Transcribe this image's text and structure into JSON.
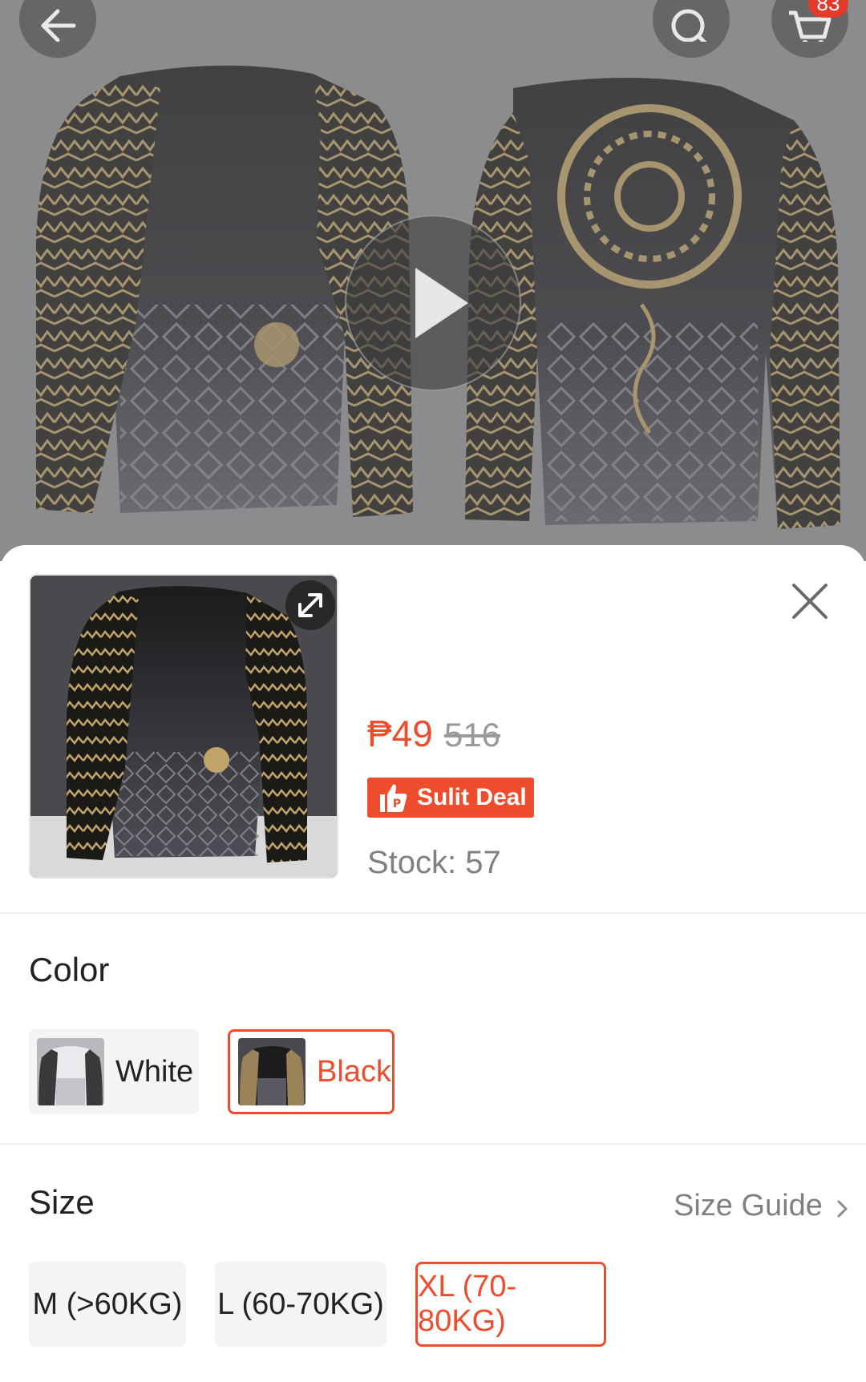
{
  "header": {
    "back_icon": "arrow-left-icon",
    "search_icon": "search-icon",
    "cart_icon": "cart-icon",
    "cart_badge": "83"
  },
  "media": {
    "play_icon": "play-icon"
  },
  "product": {
    "price": "₱49",
    "original_price": "516",
    "deal_label": "Sulit Deal",
    "stock": "Stock: 57",
    "colors": {
      "accent": "#ee4d2d",
      "muted": "#808080"
    }
  },
  "variations": {
    "color_title": "Color",
    "color_options": [
      {
        "label": "White",
        "selected": false
      },
      {
        "label": "Black",
        "selected": true
      }
    ],
    "size_title": "Size",
    "size_guide": "Size Guide",
    "size_options": [
      {
        "label": "M (>60KG)",
        "selected": false
      },
      {
        "label": "L (60-70KG)",
        "selected": false
      },
      {
        "label": "XL (70-80KG)",
        "selected": true
      }
    ]
  }
}
